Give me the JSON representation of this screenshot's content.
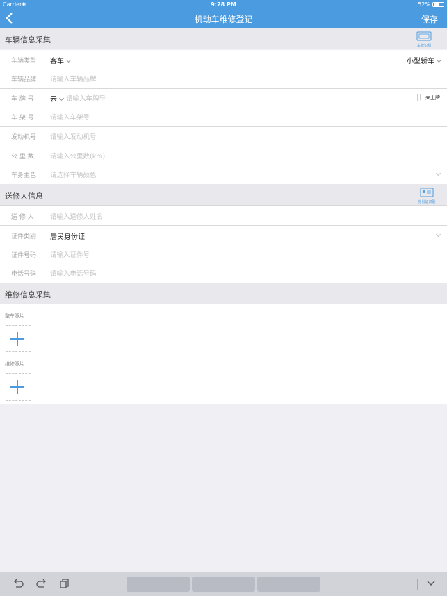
{
  "status_bar": {
    "carrier": "Carrier",
    "time": "9:28 PM",
    "battery": "52%"
  },
  "nav": {
    "title": "机动车维修登记",
    "save_label": "保存"
  },
  "vehicle_section": {
    "title": "车辆信息采集",
    "scan_label": "车牌识别",
    "rows": {
      "type": {
        "label": "车辆类型",
        "value": "客车",
        "right_value": "小型轿车"
      },
      "brand": {
        "label": "车辆品牌",
        "placeholder": "请输入车辆品牌"
      },
      "plate": {
        "label": "车 牌 号",
        "prefix": "云",
        "placeholder": "请输入车牌号",
        "unplated": "未上牌"
      },
      "frame": {
        "label": "车 架 号",
        "placeholder": "请输入车架号"
      },
      "engine": {
        "label": "发动机号",
        "placeholder": "请输入发动机号"
      },
      "mileage": {
        "label": "公 里 数",
        "placeholder": "请输入公里数(km)"
      },
      "color": {
        "label": "车身主色",
        "placeholder": "请选择车辆颜色"
      }
    }
  },
  "sender_section": {
    "title": "送修人信息",
    "scan_label": "身份证识别",
    "rows": {
      "name": {
        "label": "送 修 人",
        "placeholder": "请输入送修人姓名"
      },
      "id_type": {
        "label": "证件类别",
        "value": "居民身份证"
      },
      "id_number": {
        "label": "证件号码",
        "placeholder": "请输入证件号"
      },
      "phone": {
        "label": "电话号码",
        "placeholder": "请输入电话号码"
      }
    }
  },
  "repair_section": {
    "title": "维修信息采集",
    "whole_car_photo": "整车照片",
    "repair_photo": "维修照片"
  },
  "colors": {
    "accent": "#4a9be0",
    "background": "#efeff4"
  }
}
